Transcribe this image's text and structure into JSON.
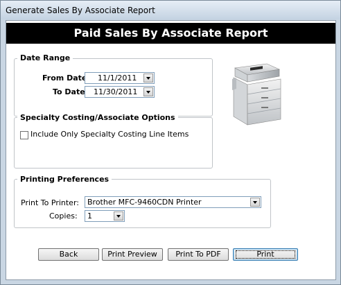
{
  "window": {
    "title": "Generate Sales By Associate Report"
  },
  "banner": {
    "text": "Paid Sales By Associate Report"
  },
  "date_range": {
    "legend": "Date Range",
    "from_label": "From Date:",
    "from_value": "11/1/2011",
    "to_label": "To Date:",
    "to_value": "11/30/2011"
  },
  "specialty": {
    "legend": "Specialty Costing/Associate Options",
    "checkbox_label": "Include Only Specialty Costing Line Items",
    "checked": false
  },
  "printing": {
    "legend": "Printing Preferences",
    "printer_label": "Print To Printer:",
    "printer_value": "Brother MFC-9460CDN Printer",
    "copies_label": "Copies:",
    "copies_value": "1"
  },
  "buttons": {
    "back": "Back",
    "print_preview": "Print Preview",
    "print_to_pdf": "Print To PDF",
    "print": "Print"
  },
  "colors": {
    "banner_bg": "#000000",
    "banner_fg": "#ffffff",
    "window_frame": "#c9d6e3"
  },
  "icons": {
    "printer_image": "copier-printer-icon"
  }
}
